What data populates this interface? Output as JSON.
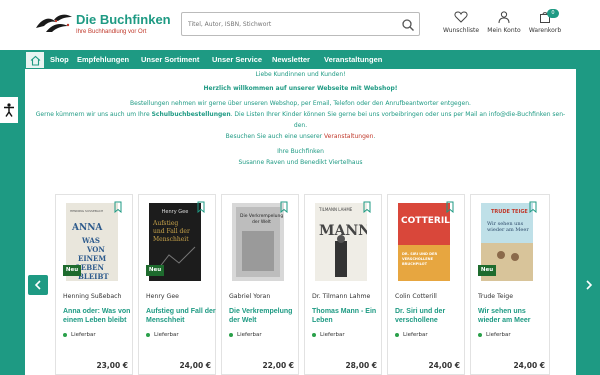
{
  "header": {
    "logo_title": "Die Buchfinken",
    "logo_subtitle": "Ihre Buchhandlung vor Ort",
    "search_placeholder": "Titel, Autor, ISBN, Stichwort",
    "wishlist_label": "Wunschliste",
    "account_label": "Mein Konto",
    "cart_label": "Warenkorb",
    "cart_count": "0"
  },
  "nav": {
    "items": [
      "Shop",
      "Empfehlungen",
      "Unser Sortiment",
      "Unser Service",
      "Newsletter",
      "Veranstaltungen"
    ]
  },
  "welcome": {
    "greeting": "Liebe Kundinnen und Kunden!",
    "headline": "Herzlich willkommen auf unserer Webseite mit Webshop!",
    "line1": "Bestellungen nehmen wir gerne über unseren Webshop, per Email, Telefon oder den Anrufbeantworter entgegen.",
    "line2_a": "Gerne kümmern wir uns auch um Ihre ",
    "line2_b": "Schulbuchbestellungen",
    "line2_c": ". Die Listen Ihrer Kinder können Sie gerne bei uns vorbeibringen oder uns per Mail an info@die-Buchfinken sen-",
    "line2_d": "den.",
    "line3_a": "Besuchen Sie auch eine unserer ",
    "line3_b": "Veranstaltungen",
    "line3_c": ".",
    "sign1": "Ihre Buchfinken",
    "sign2": "Susanne Raven und Benedikt Viertelhaus"
  },
  "products": [
    {
      "author": "Henning Sußebach",
      "title": "Anna oder: Was von einem Leben bleibt",
      "availability": "Lieferbar",
      "price": "23,00 €",
      "badge": "Neu",
      "cover_text": "ANNA",
      "cover_sub": "WAS VON EINEM LEBEN BLEIBT",
      "cover_author": "HENNING SUSSEBACH"
    },
    {
      "author": "Henry Gee",
      "title": "Aufstieg und Fall der Menschheit",
      "availability": "Lieferbar",
      "price": "24,00 €",
      "badge": "Neu",
      "cover_text": "Aufstieg und Fall der Menschheit",
      "cover_author": "Henry Gee"
    },
    {
      "author": "Gabriel Yoran",
      "title": "Die Verkrempelung der Welt",
      "availability": "Lieferbar",
      "price": "22,00 €",
      "badge": "",
      "cover_text": "Die Verkrempelung der Welt"
    },
    {
      "author": "Dr. Tilmann Lahme",
      "title": "Thomas Mann - Ein Leben",
      "availability": "Lieferbar",
      "price": "28,00 €",
      "badge": "",
      "cover_text": "MANN",
      "cover_author": "TILMANN LAHME"
    },
    {
      "author": "Colin Cotterill",
      "title": "Dr. Siri und der verschollene Bruchpi...",
      "availability": "Lieferbar",
      "price": "24,00 €",
      "badge": "",
      "cover_text": "COTTERILL",
      "cover_sub": "DR. SIRI UND DER VERSCHOLLENE BRUCHPILOT"
    },
    {
      "author": "Trude Teige",
      "title": "Wir sehen uns wieder am Meer",
      "availability": "Lieferbar",
      "price": "24,00 €",
      "badge": "Neu",
      "cover_text": "TRUDE TEIGE",
      "cover_sub": "Wir sehen uns wieder am Meer"
    }
  ],
  "colors": {
    "brand": "#1e9a83",
    "accent_red": "#c0392b",
    "new_badge": "#1e6b2e",
    "in_stock": "#2aa04a"
  }
}
